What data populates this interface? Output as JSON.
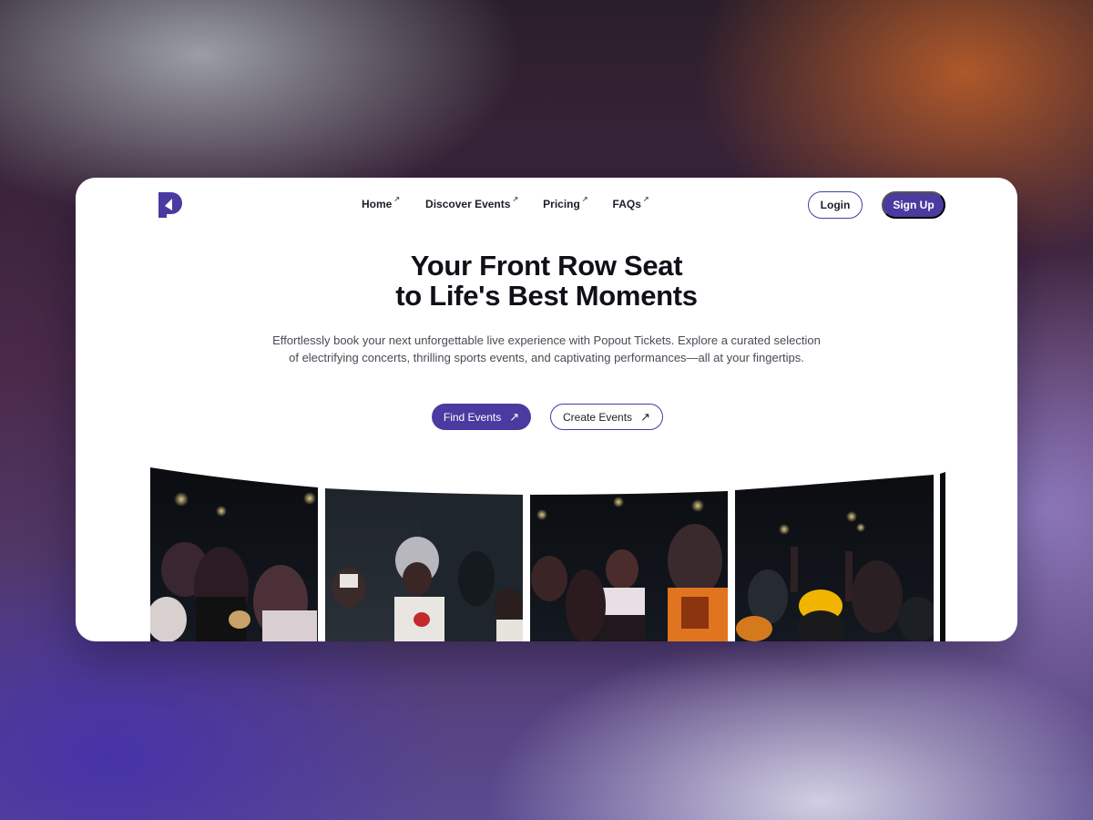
{
  "brand": {
    "logo": "popout-logo",
    "accent_color": "#4b3aa0"
  },
  "nav": {
    "items": [
      {
        "label": "Home",
        "ext": "↗"
      },
      {
        "label": "Discover Events",
        "ext": "↗"
      },
      {
        "label": "Pricing",
        "ext": "↗"
      },
      {
        "label": "FAQs",
        "ext": "↗"
      }
    ],
    "login_label": "Login",
    "signup_label": "Sign Up"
  },
  "hero": {
    "headline_line1": "Your Front Row Seat",
    "headline_line2": "to Life's Best Moments",
    "subtext": "Effortlessly book your next unforgettable live experience with Popout Tickets. Explore a curated selection of electrifying concerts, thrilling sports events, and captivating performances—all at your fingertips.",
    "find_events_label": "Find Events",
    "create_events_label": "Create Events",
    "button_icon": "arrow-up-right-icon"
  },
  "gallery": {
    "photos": [
      {
        "name": "crowd-photo-1"
      },
      {
        "name": "crowd-photo-2"
      },
      {
        "name": "crowd-photo-3"
      },
      {
        "name": "crowd-photo-4"
      }
    ]
  }
}
